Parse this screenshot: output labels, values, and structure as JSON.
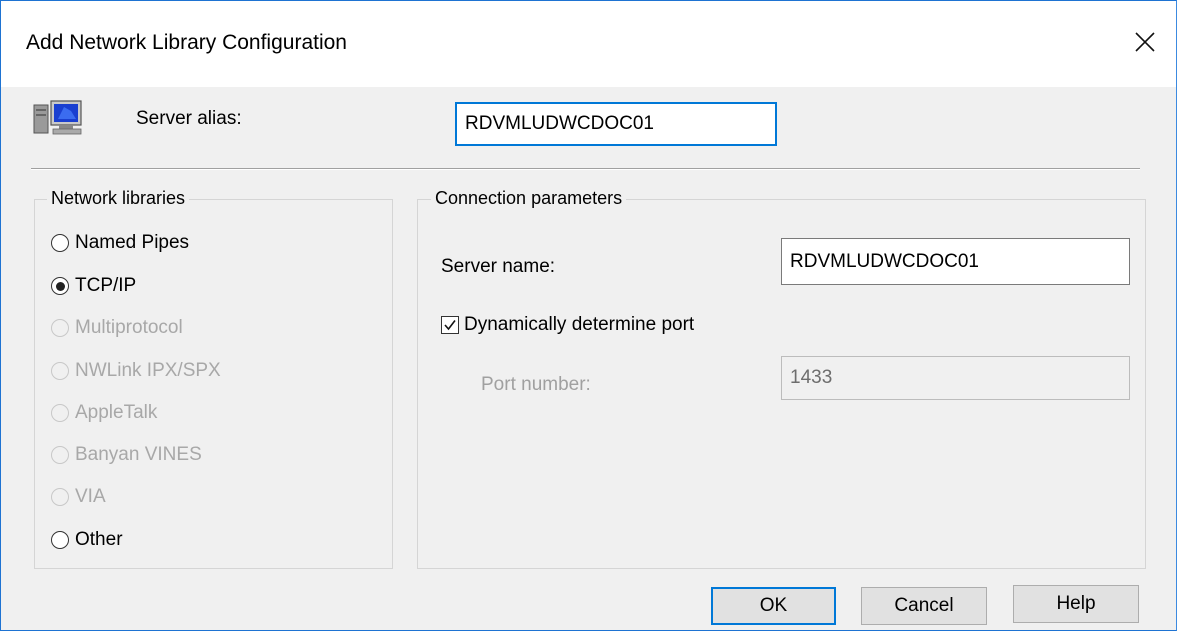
{
  "window": {
    "title": "Add Network Library Configuration"
  },
  "alias": {
    "label": "Server alias:",
    "value": "RDVMLUDWCDOC01"
  },
  "network_libraries": {
    "label": "Network libraries",
    "options": [
      {
        "label": "Named Pipes",
        "checked": false,
        "enabled": true
      },
      {
        "label": "TCP/IP",
        "checked": true,
        "enabled": true
      },
      {
        "label": "Multiprotocol",
        "checked": false,
        "enabled": false
      },
      {
        "label": "NWLink IPX/SPX",
        "checked": false,
        "enabled": false
      },
      {
        "label": "AppleTalk",
        "checked": false,
        "enabled": false
      },
      {
        "label": "Banyan VINES",
        "checked": false,
        "enabled": false
      },
      {
        "label": "VIA",
        "checked": false,
        "enabled": false
      },
      {
        "label": "Other",
        "checked": false,
        "enabled": true
      }
    ]
  },
  "connection": {
    "label": "Connection parameters",
    "server_name_label": "Server name:",
    "server_name_value": "RDVMLUDWCDOC01",
    "dynamic_port_label": "Dynamically determine port",
    "dynamic_port_checked": true,
    "port_label": "Port number:",
    "port_value": "1433"
  },
  "buttons": {
    "ok": "OK",
    "cancel": "Cancel",
    "help": "Help"
  },
  "colors": {
    "accent": "#0078d7",
    "window_bg": "#f0f0f0",
    "disabled_text": "#a8a8a8"
  }
}
